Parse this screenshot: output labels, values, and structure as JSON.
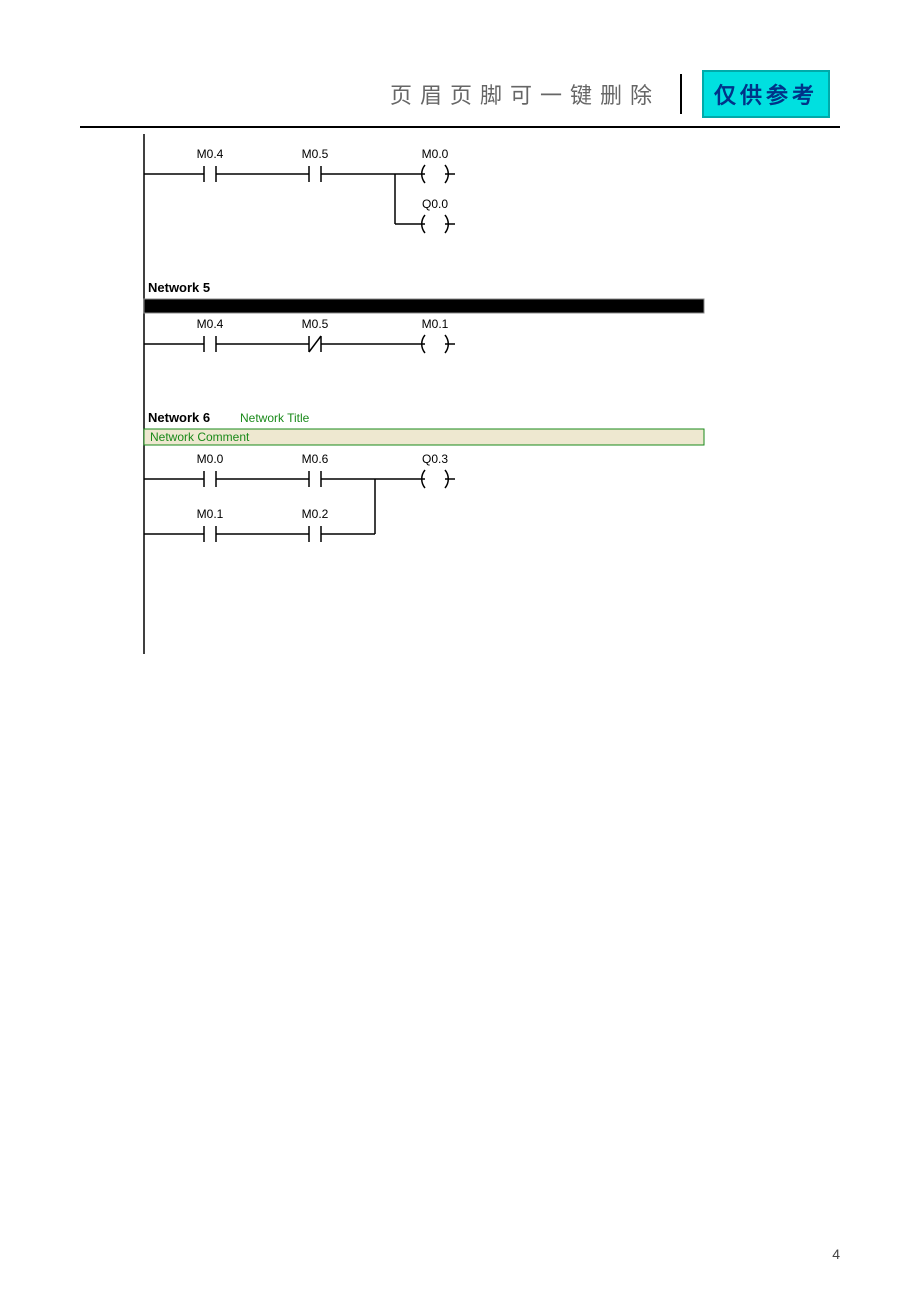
{
  "header": {
    "text": "页眉页脚可一键删除",
    "badge": "仅供参考"
  },
  "page_number": "4",
  "networks": {
    "top": {
      "c1": "M0.4",
      "c2": "M0.5",
      "out1": "M0.0",
      "out2": "Q0.0"
    },
    "n5": {
      "label": "Network 5",
      "c1": "M0.4",
      "c2": "M0.5",
      "out": "M0.1"
    },
    "n6": {
      "label": "Network 6",
      "title": "Network Title",
      "comment": "Network Comment",
      "r1c1": "M0.0",
      "r1c2": "M0.6",
      "r1out": "Q0.3",
      "r2c1": "M0.1",
      "r2c2": "M0.2"
    }
  }
}
